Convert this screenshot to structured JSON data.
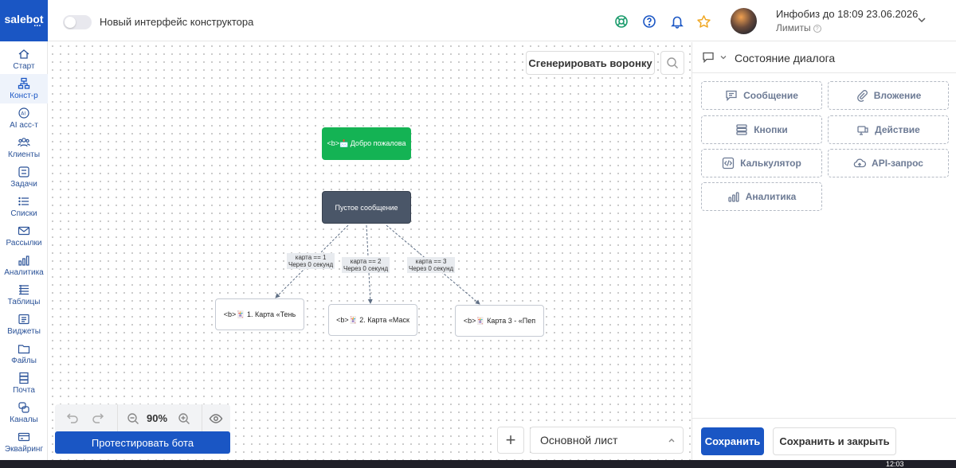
{
  "logo": {
    "text": "salebot",
    "dots": "•••"
  },
  "sidebar": {
    "items": [
      {
        "label": "Старт",
        "icon": "home-icon"
      },
      {
        "label": "Конст-р",
        "icon": "sitemap-icon",
        "active": true
      },
      {
        "label": "AI асс-т",
        "icon": "ai-icon"
      },
      {
        "label": "Клиенты",
        "icon": "users-icon"
      },
      {
        "label": "Задачи",
        "icon": "tasks-icon"
      },
      {
        "label": "Списки",
        "icon": "list-icon"
      },
      {
        "label": "Рассылки",
        "icon": "mail-icon"
      },
      {
        "label": "Аналитика",
        "icon": "bars-icon"
      },
      {
        "label": "Таблицы",
        "icon": "table-icon"
      },
      {
        "label": "Виджеты",
        "icon": "widget-icon"
      },
      {
        "label": "Файлы",
        "icon": "folder-icon"
      },
      {
        "label": "Почта",
        "icon": "inbox-icon"
      },
      {
        "label": "Каналы",
        "icon": "channels-icon"
      },
      {
        "label": "Эквайринг",
        "icon": "card-icon"
      }
    ]
  },
  "topbar": {
    "toggle_label": "Новый интерфейс конструктора",
    "plan": "Инфобиз до 18:09 23.06.2026",
    "limits": "Лимиты",
    "limits_help": "?"
  },
  "canvas": {
    "generate_button": "Сгенерировать воронку",
    "nodes": {
      "start": "<b>📩 Добро пожалова",
      "empty": "Пустое сообщение",
      "card1": "<b>🃏 1. Карта «Тень",
      "card2": "<b>🃏 2. Карта «Маск",
      "card3": "<b>🃏 Карта 3 - «Пеп"
    },
    "edges": [
      {
        "cond": "карта == 1",
        "delay": "Через 0 секунд"
      },
      {
        "cond": "карта == 2",
        "delay": "Через 0 секунд"
      },
      {
        "cond": "карта == 3",
        "delay": "Через 0 секунд"
      }
    ],
    "zoom": "90%",
    "test_button": "Протестировать бота",
    "add_sheet": "+",
    "sheet_name": "Основной лист"
  },
  "panel": {
    "title": "Состояние диалога",
    "blocks": [
      {
        "label": "Сообщение",
        "icon": "message-icon"
      },
      {
        "label": "Вложение",
        "icon": "paperclip-icon"
      },
      {
        "label": "Кнопки",
        "icon": "buttons-icon"
      },
      {
        "label": "Действие",
        "icon": "action-icon"
      },
      {
        "label": "Калькулятор",
        "icon": "code-icon"
      },
      {
        "label": "API-запрос",
        "icon": "cloud-icon"
      },
      {
        "label": "Аналитика",
        "icon": "bars-icon"
      }
    ],
    "save": "Сохранить",
    "save_close": "Сохранить и закрыть"
  },
  "taskbar": {
    "time": "12:03"
  },
  "colors": {
    "brand": "#1a56c4",
    "start_node": "#14b354",
    "dark_node": "#4a5668"
  }
}
